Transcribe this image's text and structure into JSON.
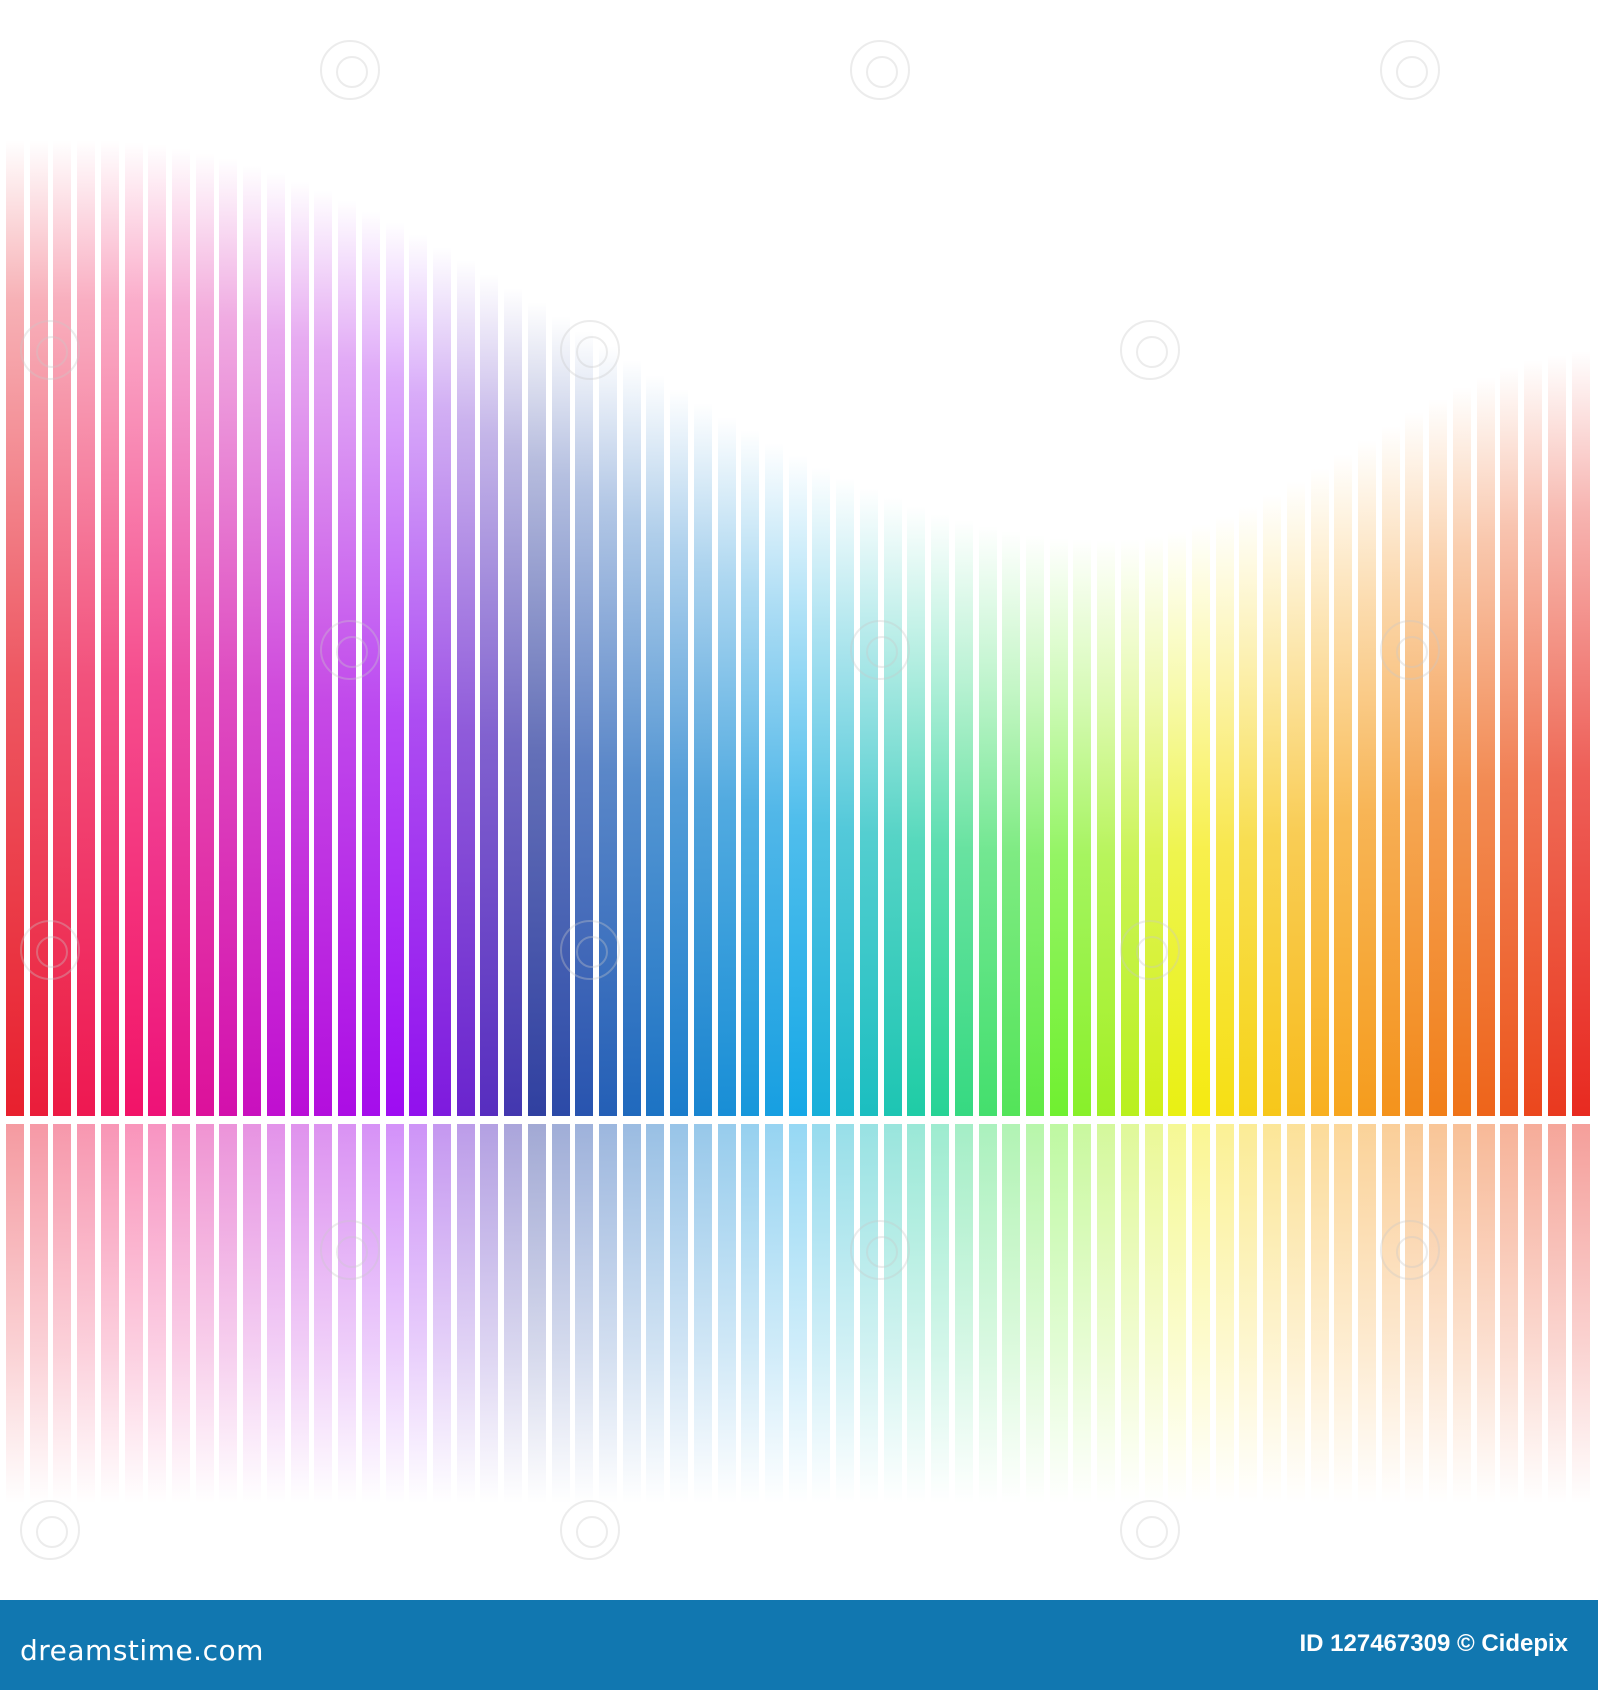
{
  "footer": {
    "brand": "dreamstime.com",
    "credit": "ID 127467309 © Cidepix",
    "background": "#1177b0"
  },
  "spectrum_colors": [
    "#e8202e",
    "#f3126e",
    "#c00fd0",
    "#9b0cf5",
    "#3040a0",
    "#1a78c8",
    "#16a8e6",
    "#20d0a0",
    "#70f030",
    "#f5f010",
    "#f8b020",
    "#f07a18",
    "#e82a20"
  ]
}
